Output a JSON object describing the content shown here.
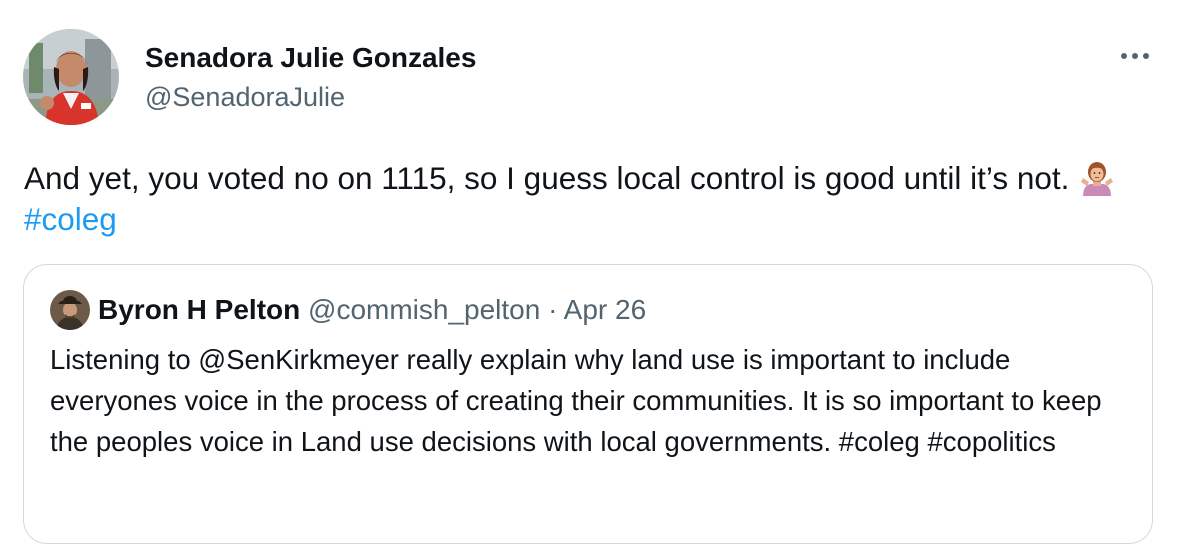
{
  "author": {
    "display_name": "Senadora Julie Gonzales",
    "handle": "@SenadoraJulie",
    "avatar_icon": "profile-photo"
  },
  "more_icon": "more-horizontal-icon",
  "tweet": {
    "text_before": "And yet, you voted no on 1115, so I guess local control is good until it’s not.",
    "emoji": "person-shrugging-emoji",
    "hashtag": "#coleg"
  },
  "quoted_tweet": {
    "display_name": "Byron H Pelton",
    "handle": "@commish_pelton",
    "separator": "·",
    "date": "Apr 26",
    "text": "Listening to @SenKirkmeyer really explain why land use is important to include everyones voice in the process of creating their communities. It is so important to keep the peoples voice in Land use decisions with local governments. #coleg #copolitics"
  },
  "colors": {
    "text": "#0f1419",
    "secondary": "#536471",
    "link": "#1d9bf0",
    "border": "#cfd9de"
  }
}
